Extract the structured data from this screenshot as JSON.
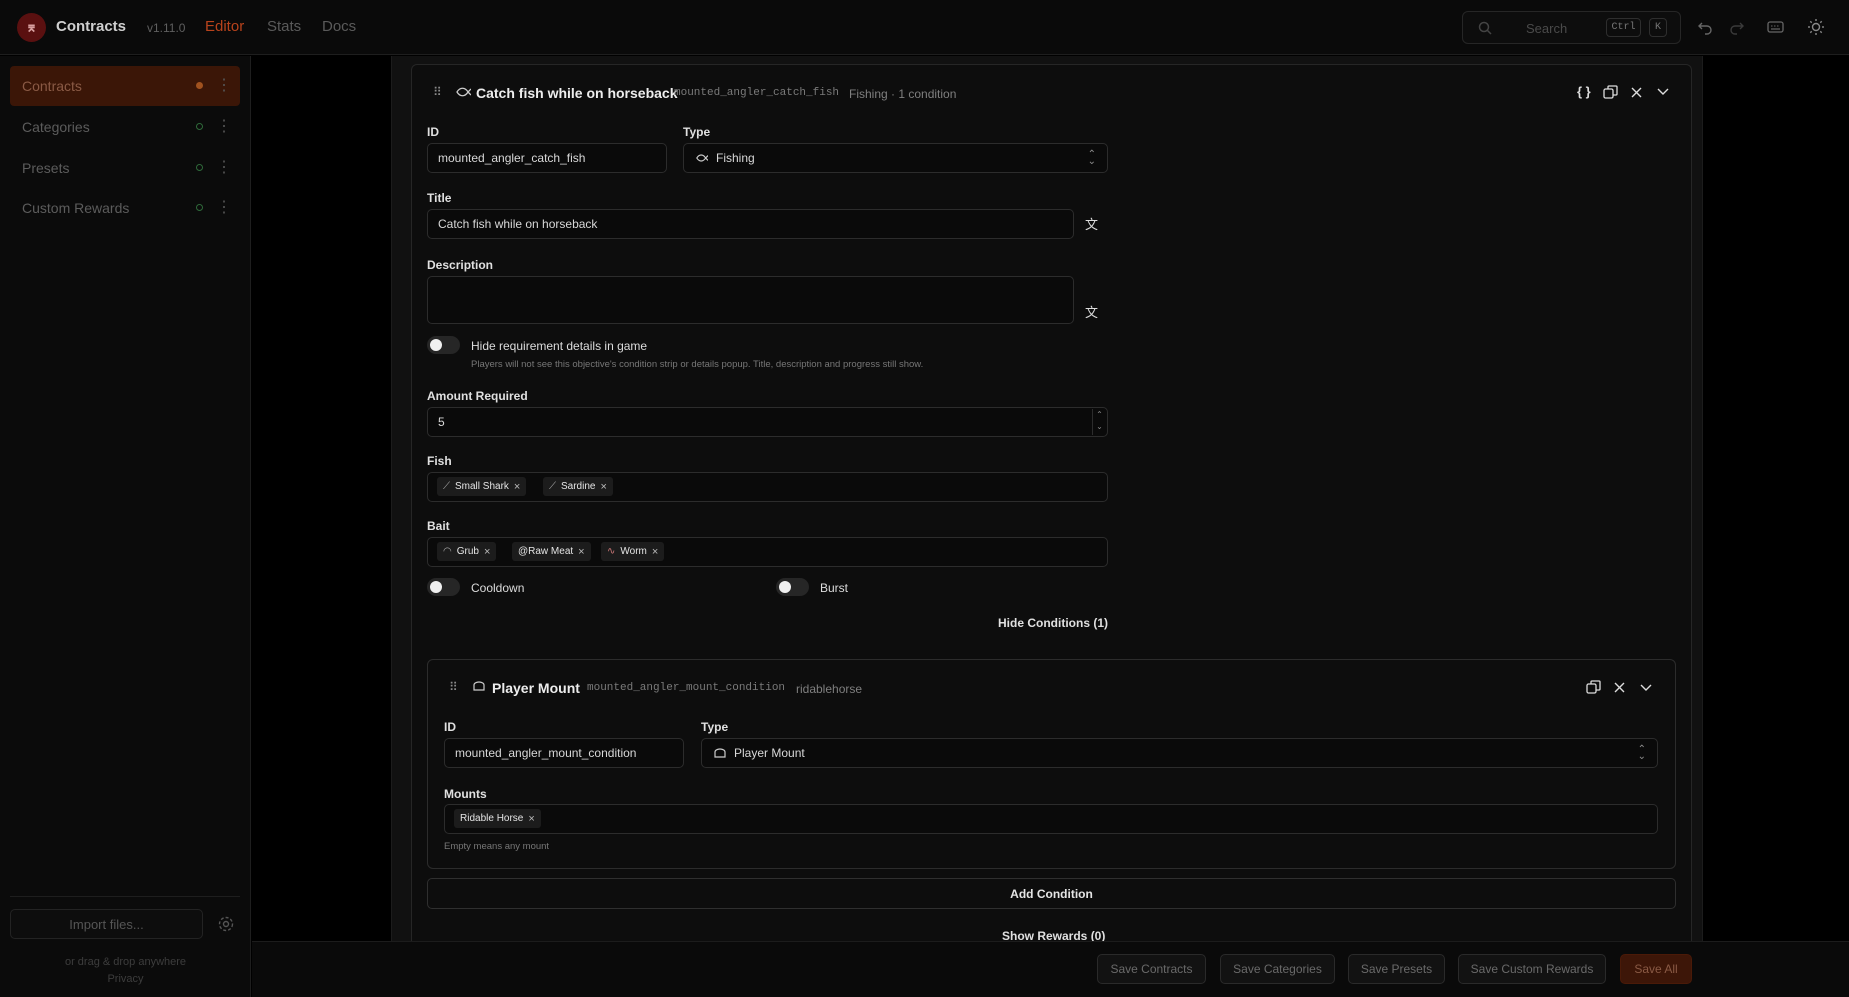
{
  "app": {
    "title": "Contracts",
    "version": "v1.11.0",
    "nav": [
      "Editor",
      "Stats",
      "Docs"
    ],
    "active_nav": "Editor",
    "search_placeholder": "Search",
    "shortcut": [
      "Ctrl",
      "K"
    ]
  },
  "sidebar": {
    "items": [
      {
        "label": "Contracts",
        "active": true
      },
      {
        "label": "Categories"
      },
      {
        "label": "Presets"
      },
      {
        "label": "Custom Rewards"
      }
    ],
    "import_label": "Import files...",
    "drag_hint": "or drag & drop anywhere",
    "privacy": "Privacy"
  },
  "objective": {
    "title": "Catch fish while on horseback",
    "id": "mounted_angler_catch_fish",
    "meta": "Fishing · 1 condition",
    "id_label": "ID",
    "id_value": "mounted_angler_catch_fish",
    "type_label": "Type",
    "type_value": "Fishing",
    "title_label": "Title",
    "title_value": "Catch fish while on horseback",
    "description_label": "Description",
    "description_value": "",
    "hide_details_label": "Hide requirement details in game",
    "hide_details_help": "Players will not see this objective's condition strip or details popup. Title, description and progress still show.",
    "amount_label": "Amount Required",
    "amount_value": "5",
    "fish_label": "Fish",
    "fish": [
      "Small Shark",
      "Sardine"
    ],
    "bait_label": "Bait",
    "bait": [
      "Grub",
      "@Raw Meat",
      "Worm"
    ],
    "cooldown_label": "Cooldown",
    "burst_label": "Burst",
    "hide_conditions": "Hide Conditions (1)",
    "show_rewards": "Show Rewards (0)",
    "add_condition": "Add Condition"
  },
  "condition": {
    "title": "Player Mount",
    "id": "mounted_angler_mount_condition",
    "meta": "ridablehorse",
    "id_label": "ID",
    "id_value": "mounted_angler_mount_condition",
    "type_label": "Type",
    "type_value": "Player Mount",
    "mounts_label": "Mounts",
    "mounts": [
      "Ridable Horse"
    ],
    "mounts_help": "Empty means any mount"
  },
  "footer": {
    "buttons": [
      "Save Contracts",
      "Save Categories",
      "Save Presets",
      "Save Custom Rewards",
      "Save All"
    ]
  },
  "colors": {
    "accent": "#b8431c",
    "active_bg": "#3b1607",
    "background": "#000000",
    "panel": "#111111"
  }
}
